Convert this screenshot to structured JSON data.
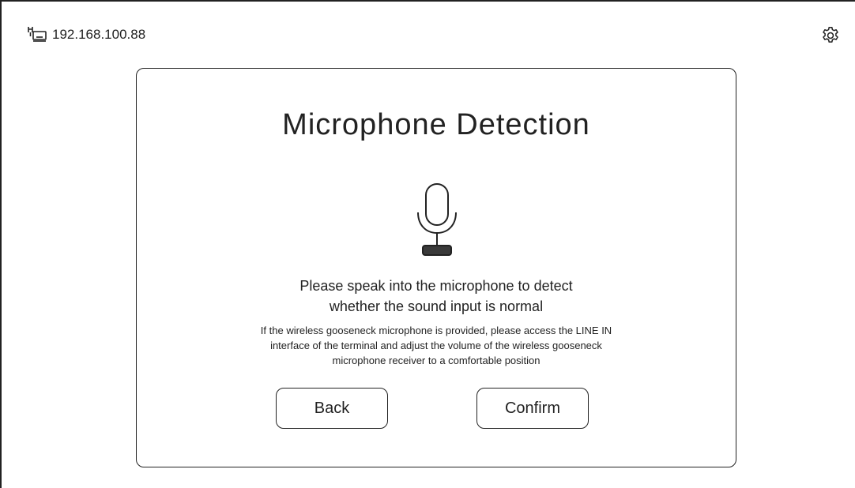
{
  "header": {
    "network_icon": "ethernet-monitor-icon",
    "ip_address": "192.168.100.88",
    "settings_icon": "gear-icon"
  },
  "dialog": {
    "title": "Microphone Detection",
    "icon": "microphone-icon",
    "instruction_line1": "Please speak into the microphone to detect",
    "instruction_line2": "whether the sound input is normal",
    "note_line1": "If the wireless gooseneck microphone is provided, please access the LINE IN",
    "note_line2": "interface of the terminal and adjust the volume of the wireless gooseneck",
    "note_line3": "microphone receiver to a comfortable position",
    "back_label": "Back",
    "confirm_label": "Confirm"
  }
}
